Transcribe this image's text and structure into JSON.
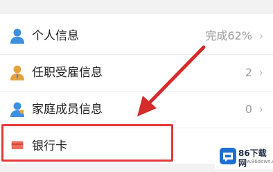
{
  "list": {
    "items": [
      {
        "label": "个人信息",
        "value": "完成62%",
        "icon": "person-icon"
      },
      {
        "label": "任职受雇信息",
        "value": "2",
        "icon": "employee-icon"
      },
      {
        "label": "家庭成员信息",
        "value": "0",
        "icon": "family-icon"
      },
      {
        "label": "银行卡",
        "value": "",
        "icon": "bank-card-icon"
      }
    ],
    "chevron": "›"
  },
  "colors": {
    "highlight": "#e53935",
    "arrow": "#d62b2b",
    "person_icon": "#3d8fe0",
    "employee_icon": "#e6a23c",
    "card_icon": "#f26b5b"
  },
  "watermark": {
    "text": "86下载网",
    "sub": "www.86down.com"
  }
}
